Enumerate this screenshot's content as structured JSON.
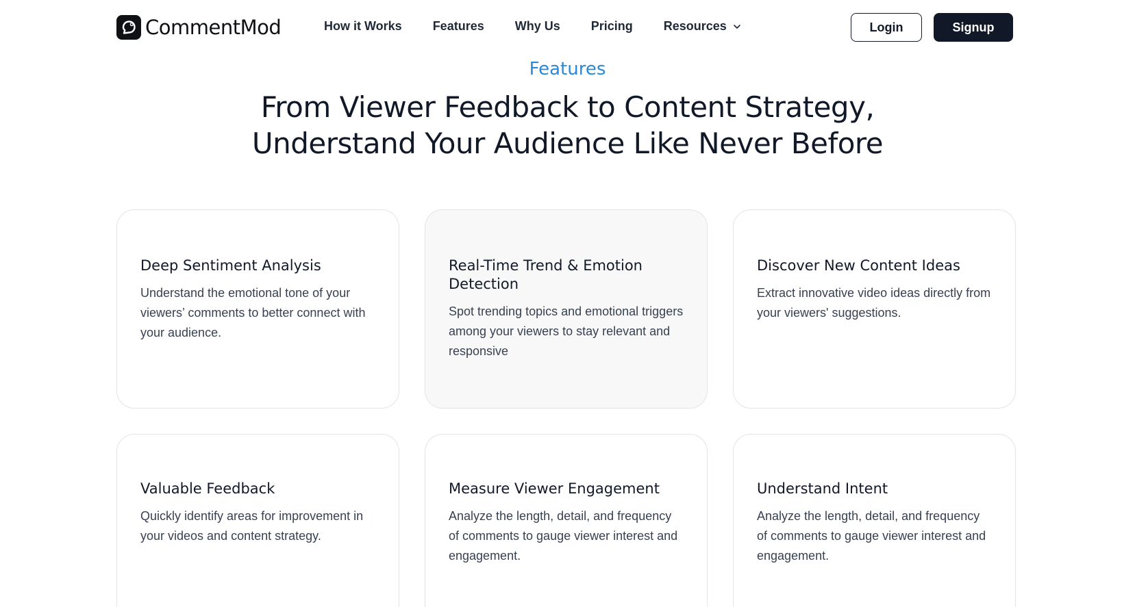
{
  "brand": {
    "name": "CommentMod"
  },
  "nav": {
    "items": [
      "How it Works",
      "Features",
      "Why Us",
      "Pricing",
      "Resources"
    ],
    "login": "Login",
    "signup": "Signup"
  },
  "hero": {
    "eyebrow": "Features",
    "headline_line1": "From Viewer Feedback to Content Strategy,",
    "headline_line2": "Understand Your Audience Like Never Before"
  },
  "features": [
    {
      "title": "Deep Sentiment Analysis",
      "desc": "Understand the emotional tone of your viewers’ comments to better connect with your audience."
    },
    {
      "title": "Real-Time Trend & Emotion Detection",
      "desc": "Spot trending topics and emotional triggers among your viewers to stay relevant and responsive"
    },
    {
      "title": "Discover New Content Ideas",
      "desc": "Extract innovative video ideas directly from your viewers' suggestions."
    },
    {
      "title": "Valuable Feedback",
      "desc": "Quickly identify areas for improvement in your videos and content strategy."
    },
    {
      "title": "Measure Viewer Engagement",
      "desc": "Analyze the length, detail, and frequency of comments to gauge viewer interest and engagement."
    },
    {
      "title": "Understand Intent",
      "desc": "Analyze the length, detail, and frequency of comments to gauge viewer interest and engagement."
    }
  ],
  "colors": {
    "accent": "#2b88d8",
    "dark": "#111827",
    "card_border": "#e2e4e8",
    "card_highlight": "#f8f8f8"
  },
  "icons": {
    "logo": "comment-bubble-icon",
    "dropdown": "chevron-down-icon"
  }
}
